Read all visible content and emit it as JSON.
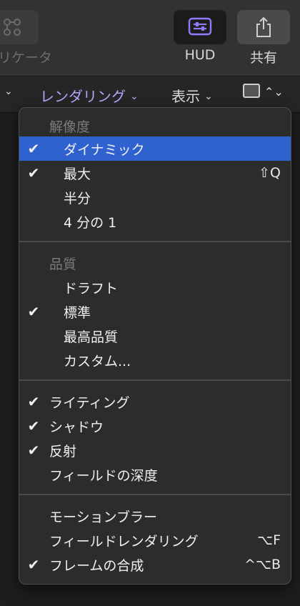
{
  "toolbar": {
    "left_label": "リケータ",
    "hud_label": "HUD",
    "share_label": "共有"
  },
  "viewbar": {
    "left_chevron": "⌄",
    "rendering": "レンダリング",
    "display": "表示",
    "chevron": "⌄",
    "stepper": "⌃⌄"
  },
  "menu": {
    "resolution": {
      "header": "解像度",
      "items": [
        {
          "label": "ダイナミック",
          "checked": true,
          "selected": true,
          "shortcut": ""
        },
        {
          "label": "最大",
          "checked": true,
          "selected": false,
          "shortcut": "⇧Q"
        },
        {
          "label": "半分",
          "checked": false,
          "selected": false,
          "shortcut": ""
        },
        {
          "label": "4 分の 1",
          "checked": false,
          "selected": false,
          "shortcut": ""
        }
      ]
    },
    "quality": {
      "header": "品質",
      "items": [
        {
          "label": "ドラフト",
          "checked": false,
          "shortcut": ""
        },
        {
          "label": "標準",
          "checked": true,
          "shortcut": ""
        },
        {
          "label": "最高品質",
          "checked": false,
          "shortcut": ""
        },
        {
          "label": "カスタム...",
          "checked": false,
          "shortcut": ""
        }
      ]
    },
    "effects": {
      "items": [
        {
          "label": "ライティング",
          "checked": true
        },
        {
          "label": "シャドウ",
          "checked": true
        },
        {
          "label": "反射",
          "checked": true
        },
        {
          "label": "フィールドの深度",
          "checked": false
        }
      ]
    },
    "render": {
      "items": [
        {
          "label": "モーションブラー",
          "checked": false,
          "shortcut": ""
        },
        {
          "label": "フィールドレンダリング",
          "checked": false,
          "shortcut": "⌥F"
        },
        {
          "label": "フレームの合成",
          "checked": true,
          "shortcut": "^⌥B"
        }
      ]
    },
    "check_glyph": "✔"
  },
  "colors": {
    "accent": "#b9a8ff",
    "selection": "#2f62cf"
  }
}
